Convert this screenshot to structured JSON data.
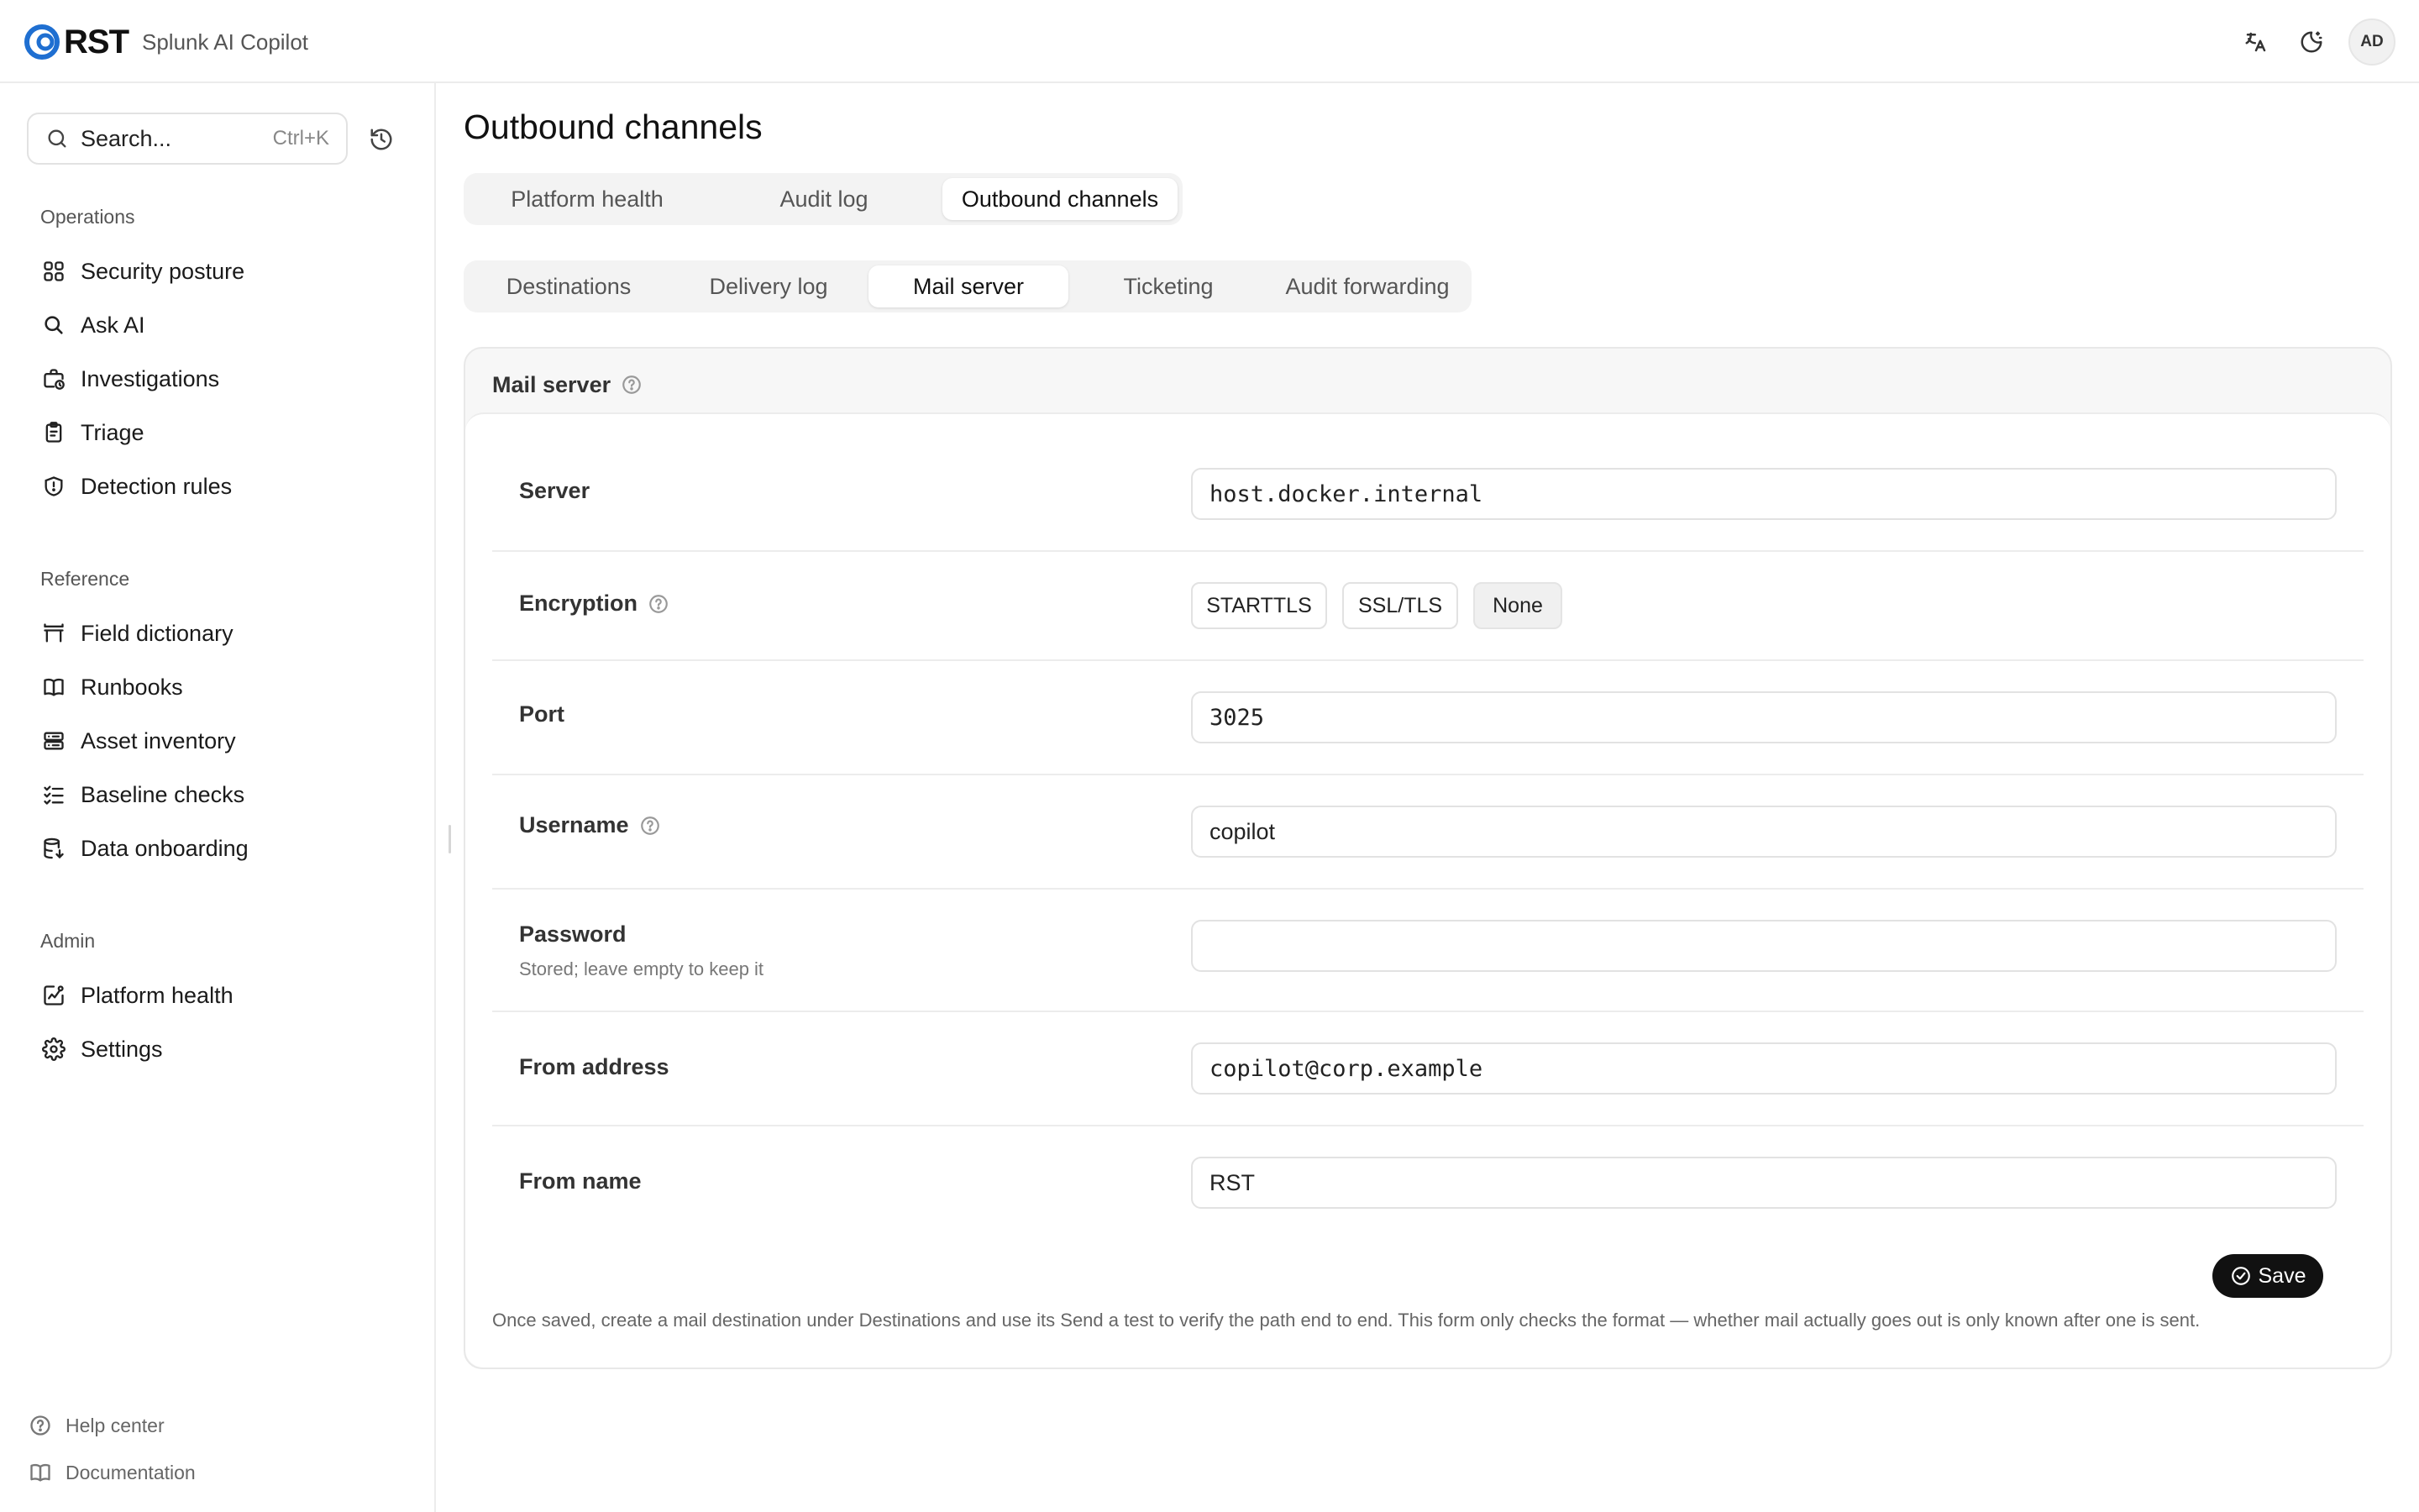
{
  "header": {
    "brand_word": "RST",
    "app_name": "Splunk AI Copilot",
    "avatar_initials": "AD"
  },
  "sidebar": {
    "search": {
      "label": "Search...",
      "shortcut": "Ctrl+K"
    },
    "sections": [
      {
        "title": "Operations",
        "items": [
          {
            "label": "Security posture",
            "icon": "grid-icon"
          },
          {
            "label": "Ask AI",
            "icon": "search-icon"
          },
          {
            "label": "Investigations",
            "icon": "briefcase-clock-icon"
          },
          {
            "label": "Triage",
            "icon": "clipboard-icon"
          },
          {
            "label": "Detection rules",
            "icon": "shield-icon"
          }
        ]
      },
      {
        "title": "Reference",
        "items": [
          {
            "label": "Field dictionary",
            "icon": "table-icon"
          },
          {
            "label": "Runbooks",
            "icon": "book-open-icon"
          },
          {
            "label": "Asset inventory",
            "icon": "server-icon"
          },
          {
            "label": "Baseline checks",
            "icon": "list-check-icon"
          },
          {
            "label": "Data onboarding",
            "icon": "database-import-icon"
          }
        ]
      },
      {
        "title": "Admin",
        "items": [
          {
            "label": "Platform health",
            "icon": "chart-pulse-icon"
          },
          {
            "label": "Settings",
            "icon": "gear-icon"
          }
        ]
      }
    ],
    "footer": [
      {
        "label": "Help center",
        "icon": "help-circle-icon"
      },
      {
        "label": "Documentation",
        "icon": "book-icon"
      }
    ]
  },
  "main": {
    "title": "Outbound channels",
    "tabs": [
      "Platform health",
      "Audit log",
      "Outbound channels"
    ],
    "subtabs": [
      "Destinations",
      "Delivery log",
      "Mail server",
      "Ticketing",
      "Audit forwarding"
    ],
    "card": {
      "title": "Mail server",
      "fields": {
        "server": {
          "label": "Server",
          "value": "host.docker.internal"
        },
        "encryption": {
          "label": "Encryption",
          "options": [
            "STARTTLS",
            "SSL/TLS",
            "None"
          ],
          "selected": "None"
        },
        "port": {
          "label": "Port",
          "value": "3025"
        },
        "username": {
          "label": "Username",
          "value": "copilot"
        },
        "password": {
          "label": "Password",
          "hint": "Stored; leave empty to keep it",
          "value": ""
        },
        "from_address": {
          "label": "From address",
          "value": "copilot@corp.example"
        },
        "from_name": {
          "label": "From name",
          "value": "RST"
        }
      },
      "save_label": "Save",
      "note": "Once saved, create a mail destination under Destinations and use its Send a test to verify the path end to end. This form only checks the format — whether mail actually goes out is only known after one is sent."
    }
  },
  "colors": {
    "brand_blue": "#1f6fd1",
    "primary_button": "#111111"
  }
}
